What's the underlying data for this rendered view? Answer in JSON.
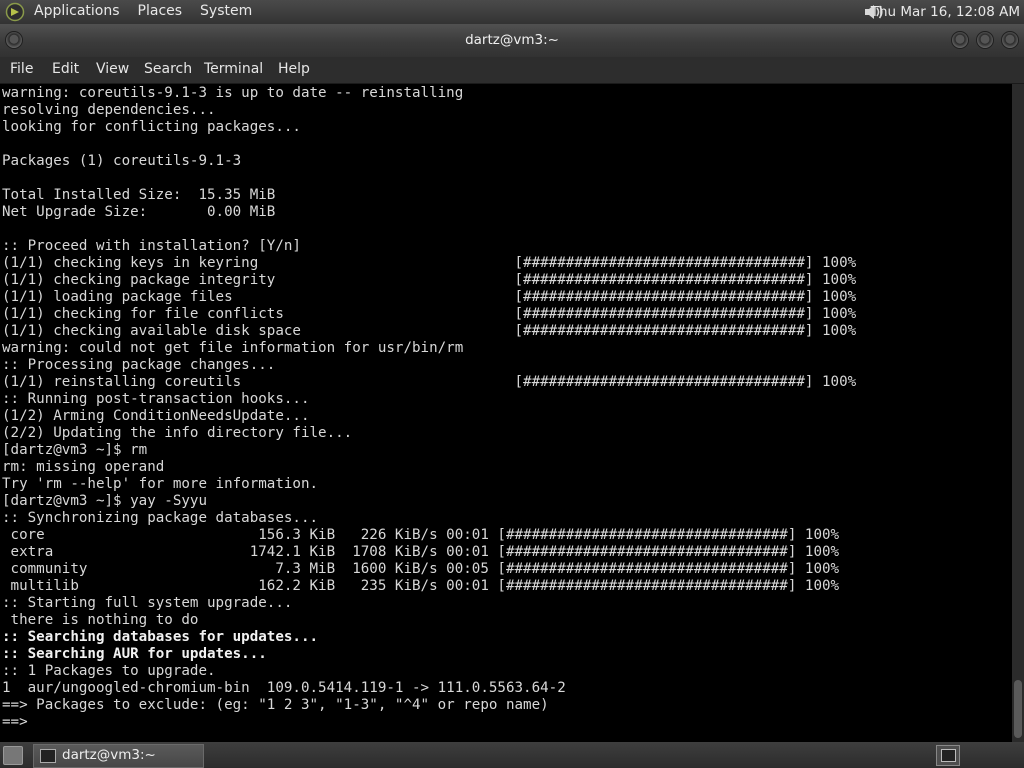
{
  "top_panel": {
    "menu": [
      "Applications",
      "Places",
      "System"
    ],
    "clock": "Thu Mar 16, 12:08 AM"
  },
  "window": {
    "title": "dartz@vm3:~"
  },
  "menubar": {
    "items": [
      "File",
      "Edit",
      "View",
      "Search",
      "Terminal",
      "Help"
    ]
  },
  "terminal": {
    "lines": [
      "warning: coreutils-9.1-3 is up to date -- reinstalling",
      "resolving dependencies...",
      "looking for conflicting packages...",
      "",
      "Packages (1) coreutils-9.1-3",
      "",
      "Total Installed Size:  15.35 MiB",
      "Net Upgrade Size:       0.00 MiB",
      "",
      ":: Proceed with installation? [Y/n]",
      "(1/1) checking keys in keyring                              [#################################] 100%",
      "(1/1) checking package integrity                            [#################################] 100%",
      "(1/1) loading package files                                 [#################################] 100%",
      "(1/1) checking for file conflicts                           [#################################] 100%",
      "(1/1) checking available disk space                         [#################################] 100%",
      "warning: could not get file information for usr/bin/rm",
      ":: Processing package changes...",
      "(1/1) reinstalling coreutils                                [#################################] 100%",
      ":: Running post-transaction hooks...",
      "(1/2) Arming ConditionNeedsUpdate...",
      "(2/2) Updating the info directory file...",
      "[dartz@vm3 ~]$ rm",
      "rm: missing operand",
      "Try 'rm --help' for more information.",
      "[dartz@vm3 ~]$ yay -Syyu",
      ":: Synchronizing package databases...",
      " core                         156.3 KiB   226 KiB/s 00:01 [#################################] 100%",
      " extra                       1742.1 KiB  1708 KiB/s 00:01 [#################################] 100%",
      " community                      7.3 MiB  1600 KiB/s 00:05 [#################################] 100%",
      " multilib                     162.2 KiB   235 KiB/s 00:01 [#################################] 100%",
      ":: Starting full system upgrade...",
      " there is nothing to do",
      ":: Searching databases for updates...",
      ":: Searching AUR for updates...",
      ":: 1 Packages to upgrade.",
      "1  aur/ungoogled-chromium-bin  109.0.5414.119-1 -> 111.0.5563.64-2",
      "==> Packages to exclude: (eg: \"1 2 3\", \"1-3\", \"^4\" or repo name)",
      "==>"
    ]
  },
  "taskbar": {
    "task_label": "dartz@vm3:~"
  },
  "colors": {
    "terminal_bg": "#000000",
    "terminal_fg": "#d8d8d8",
    "panel_bg": "#3a3a3a"
  }
}
